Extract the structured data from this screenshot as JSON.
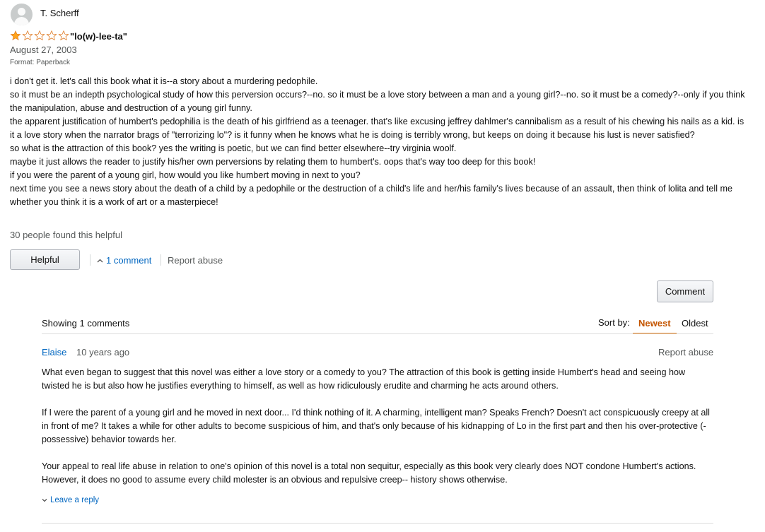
{
  "review": {
    "reviewer_name": "T. Scherff",
    "rating": 1,
    "max_rating": 5,
    "title": "\"lo(w)-lee-ta\"",
    "date": "August 27, 2003",
    "format": "Format: Paperback",
    "body_lines": [
      "i don't get it. let's call this book what it is--a story about a murdering pedophile.",
      "so it must be an indepth psychological study of how this perversion occurs?--no. so it must be a love story between a man and a young girl?--no. so it must be a comedy?--only if you think the manipulation, abuse and destruction of a young girl funny.",
      "the apparent justification of humbert's pedophilia is the death of his girlfriend as a teenager. that's like excusing jeffrey dahlmer's cannibalism as a result of his chewing his nails as a kid. is it a love story when the narrator brags of \"terrorizing lo\"? is it funny when he knows what he is doing is terribly wrong, but keeps on doing it because his lust is never satisfied?",
      "so what is the attraction of this book? yes the writing is poetic, but we can find better elsewhere--try virginia woolf.",
      "maybe it just allows the reader to justify his/her own perversions by relating them to humbert's. oops that's way too deep for this book!",
      "if you were the parent of a young girl, how would you like humbert moving in next to you?",
      "next time you see a news story about the death of a child by a pedophile or the destruction of a child's life and her/his family's lives because of an assault, then think of lolita and tell me whether you think it is a work of art or a masterpiece!"
    ],
    "helpful_count": "30 people found this helpful",
    "helpful_button": "Helpful",
    "comments_link": "1 comment",
    "report_abuse": "Report abuse"
  },
  "comments_section": {
    "comment_button": "Comment",
    "showing": "Showing 1 comments",
    "sort_label": "Sort by:",
    "sort_newest": "Newest",
    "sort_oldest": "Oldest",
    "comments": [
      {
        "author": "Elaise",
        "time": "10 years ago",
        "report_abuse": "Report abuse",
        "paragraphs": [
          "What even began to suggest that this novel was either a love story or a comedy to you? The attraction of this book is getting inside Humbert's head and seeing how twisted he is but also how he justifies everything to himself, as well as how ridiculously erudite and charming he acts around others.",
          "If I were the parent of a young girl and he moved in next door... I'd think nothing of it. A charming, intelligent man? Speaks French? Doesn't act conspicuously creepy at all in front of me? It takes a while for other adults to become suspicious of him, and that's only because of his kidnapping of Lo in the first part and then his over-protective (-possessive) behavior towards her.",
          "Your appeal to real life abuse in relation to one's opinion of this novel is a total non sequitur, especially as this book very clearly does NOT condone Humbert's actions. However, it does no good to assume every child molester is an obvious and repulsive creep-- history shows otherwise."
        ],
        "reply_link": "Leave a reply"
      }
    ]
  },
  "colors": {
    "link": "#0066c0",
    "secondary_text": "#565959",
    "star_fill": "#ffa41c",
    "sort_active": "#c45500"
  },
  "icons": {
    "avatar": "default-avatar-icon",
    "star_filled": "star-filled-icon",
    "star_empty": "star-empty-icon",
    "chevron_up": "chevron-up-icon",
    "chevron_down": "chevron-down-icon"
  }
}
